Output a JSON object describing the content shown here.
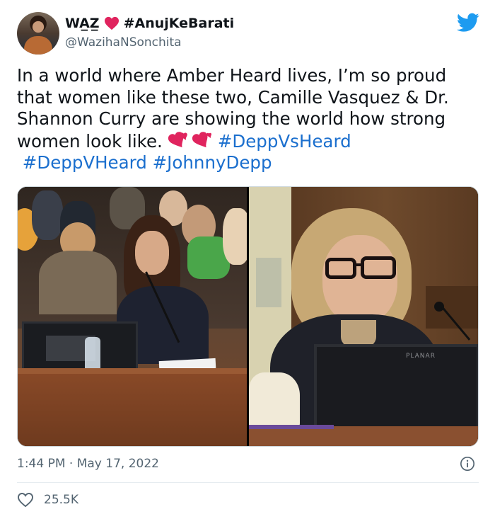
{
  "user": {
    "display_name": "WA̲Z̲ ",
    "heart": "red-heart-emoji",
    "name_suffix": "#AnujKeBarati",
    "handle": "@WazihaNSonchita"
  },
  "tweet": {
    "line1": "In a world where Amber Heard lives, I’m so proud",
    "line2": "that women like these two, Camille Vasquez & Dr.",
    "line3": "Shannon Curry are showing the world how strong",
    "line4_text": "women look like.",
    "emoji": "two-hearts-emoji",
    "hashtag1": "#DeppVsHeard",
    "hashtag2": "#DeppVHeard",
    "hashtag3": "#JohnnyDepp"
  },
  "media": {
    "left_photo": "courtroom-camille-vasquez",
    "right_photo": "courtroom-shannon-curry",
    "monitor_brand": "PLANAR"
  },
  "meta": {
    "timestamp": "1:44 PM · May 17, 2022",
    "likes": "25.5K"
  },
  "colors": {
    "hashtag": "#1b6fce",
    "twitter_blue": "#1d9bf0",
    "heart_red": "#e0245e",
    "secondary_text": "#536471"
  }
}
